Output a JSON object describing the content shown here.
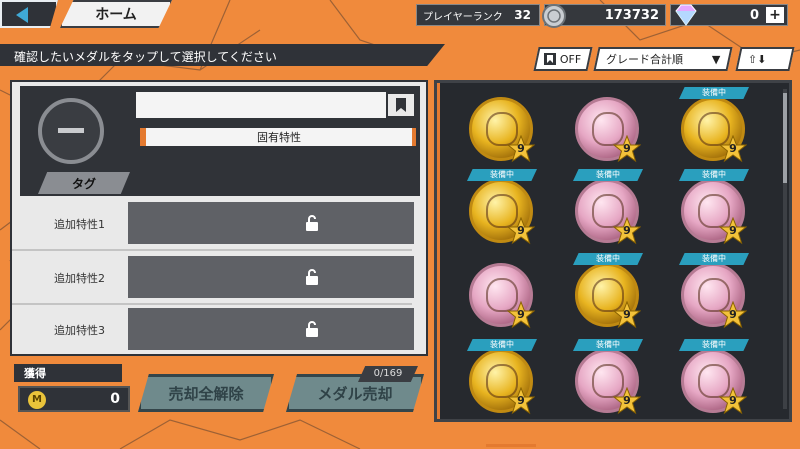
{
  "topbar": {
    "home_label": "ホーム",
    "player_rank_label": "プレイヤーランク",
    "player_rank_value": "32",
    "coins_value": "173732",
    "gems_value": "0",
    "add_label": "+"
  },
  "instruction": "確認したいメダルをタップして選択してください",
  "filters": {
    "bookmark_filter_label": "OFF",
    "sort_label": "グレード合計順",
    "order_label": "⇧⬇"
  },
  "detail": {
    "unique_trait_label": "固有特性",
    "tag_label": "タグ",
    "extra_traits": [
      {
        "label": "追加特性1"
      },
      {
        "label": "追加特性2"
      },
      {
        "label": "追加特性3"
      }
    ]
  },
  "gain": {
    "title": "獲得",
    "currency_icon": "M",
    "value": "0"
  },
  "actions": {
    "release_all_label": "売却全解除",
    "sell_label": "メダル売却",
    "count": "0/169"
  },
  "medals": [
    {
      "color": "gold",
      "equipped": false,
      "grade": "9"
    },
    {
      "color": "pink",
      "equipped": false,
      "grade": "9"
    },
    {
      "color": "gold",
      "equipped": true,
      "grade": "9"
    },
    {
      "color": "gold",
      "equipped": true,
      "grade": "9"
    },
    {
      "color": "pink",
      "equipped": true,
      "grade": "9"
    },
    {
      "color": "pink",
      "equipped": true,
      "grade": "9"
    },
    {
      "color": "pink",
      "equipped": false,
      "grade": "9"
    },
    {
      "color": "gold",
      "equipped": true,
      "grade": "9"
    },
    {
      "color": "pink",
      "equipped": true,
      "grade": "9"
    },
    {
      "color": "gold",
      "equipped": true,
      "grade": "9"
    },
    {
      "color": "pink",
      "equipped": true,
      "grade": "9"
    },
    {
      "color": "pink",
      "equipped": true,
      "grade": "9"
    }
  ],
  "equipped_tag_label": "装備中",
  "colors": {
    "accent": "#e47a30",
    "panel": "#2f3238",
    "equipped": "#2a9fbe"
  }
}
